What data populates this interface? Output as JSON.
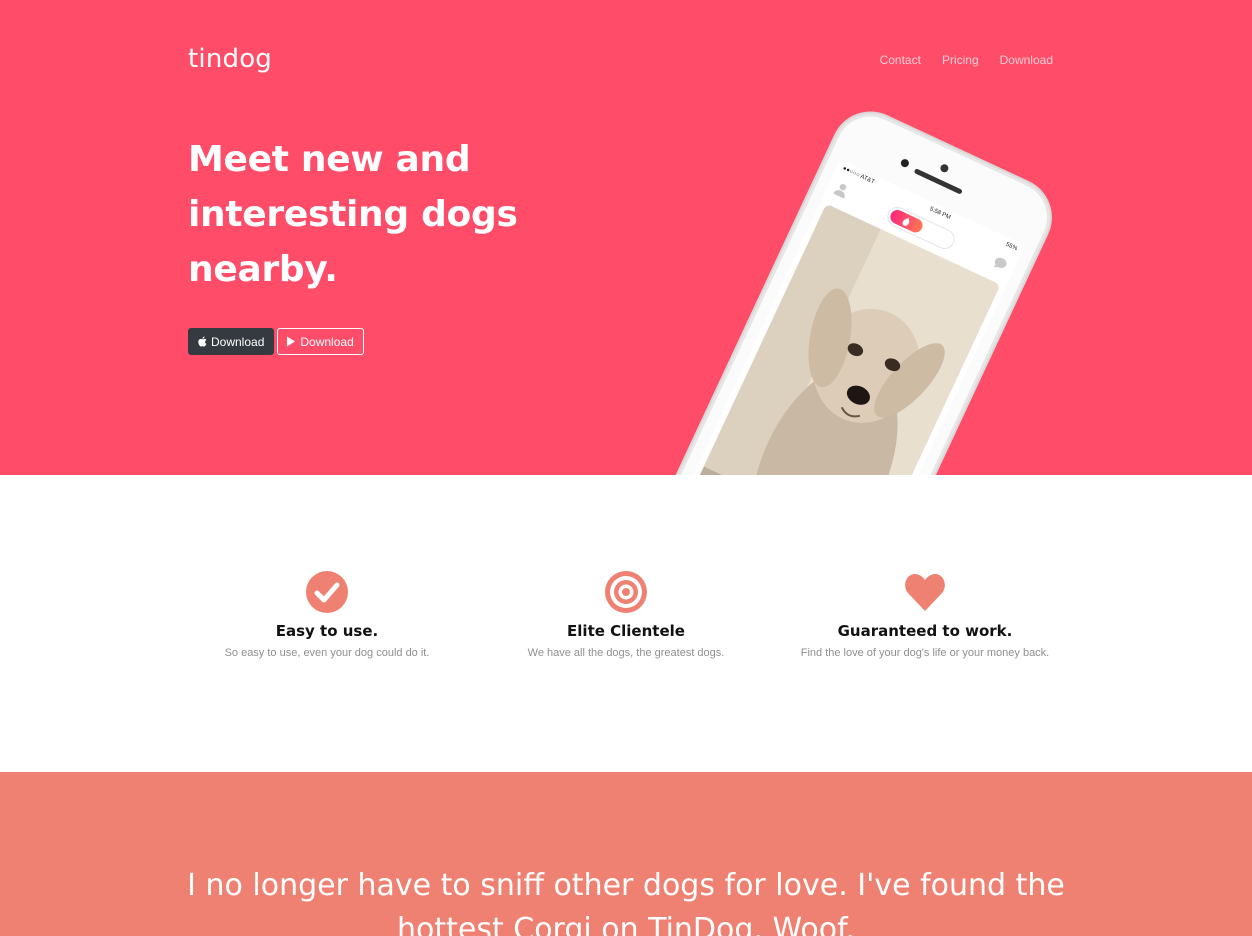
{
  "brand": "tindog",
  "nav": {
    "items": [
      {
        "label": "Contact"
      },
      {
        "label": "Pricing"
      },
      {
        "label": "Download"
      }
    ]
  },
  "hero": {
    "headline": "Meet new and interesting dogs nearby.",
    "buttons": {
      "apple": {
        "label": "Download",
        "icon": "apple-icon"
      },
      "google": {
        "label": "Download",
        "icon": "google-play-icon"
      }
    }
  },
  "phone": {
    "carrier": "●●○○○ AT&T",
    "time": "5:58 PM",
    "battery": "55%"
  },
  "features": [
    {
      "icon": "check-circle-icon",
      "title": "Easy to use.",
      "text": "So easy to use, even your dog could do it."
    },
    {
      "icon": "bullseye-icon",
      "title": "Elite Clientele",
      "text": "We have all the dogs, the greatest dogs."
    },
    {
      "icon": "heart-icon",
      "title": "Guaranteed to work.",
      "text": "Find the love of your dog's life or your money back."
    }
  ],
  "testimonial": {
    "quote": "I no longer have to sniff other dogs for love. I've found the hottest Corgi on TinDog. Woof."
  },
  "colors": {
    "hero_bg": "#ff4c68",
    "accent": "#ef8172",
    "dark_button": "#343a40"
  }
}
